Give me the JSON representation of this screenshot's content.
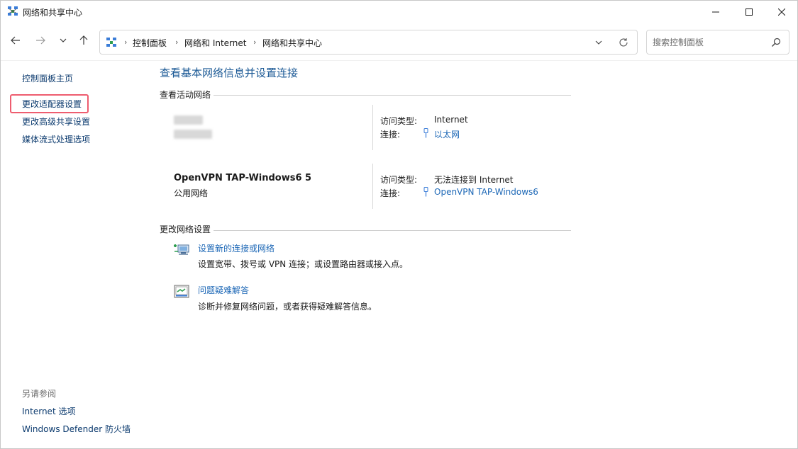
{
  "window": {
    "title": "网络和共享中心"
  },
  "breadcrumb": {
    "items": [
      "控制面板",
      "网络和 Internet",
      "网络和共享中心"
    ]
  },
  "search": {
    "placeholder": "搜索控制面板"
  },
  "sidebar": {
    "links": [
      "控制面板主页",
      "更改适配器设置",
      "更改高级共享设置",
      "媒体流式处理选项"
    ],
    "highlighted_index": 1,
    "see_also": {
      "heading": "另请参阅",
      "links": [
        "Internet 选项",
        "Windows Defender 防火墙"
      ]
    }
  },
  "main": {
    "title": "查看基本网络信息并设置连接",
    "active_networks_header": "查看活动网络",
    "networks": [
      {
        "name": "",
        "type": "",
        "name_redacted": true,
        "access_type_label": "访问类型:",
        "access_type_value": "Internet",
        "connection_label": "连接:",
        "connection_value": "以太网"
      },
      {
        "name": "OpenVPN TAP-Windows6 5",
        "type": "公用网络",
        "name_redacted": false,
        "access_type_label": "访问类型:",
        "access_type_value": "无法连接到 Internet",
        "connection_label": "连接:",
        "connection_value": "OpenVPN TAP-Windows6"
      }
    ],
    "change_settings_header": "更改网络设置",
    "tasks": [
      {
        "icon": "new-connection-icon",
        "link": "设置新的连接或网络",
        "description": "设置宽带、拨号或 VPN 连接；或设置路由器或接入点。"
      },
      {
        "icon": "troubleshoot-icon",
        "link": "问题疑难解答",
        "description": "诊断并修复网络问题，或者获得疑难解答信息。"
      }
    ]
  },
  "colors": {
    "link": "#1c67b6",
    "title": "#1c5a96",
    "highlight_border": "#ee5d6f"
  }
}
